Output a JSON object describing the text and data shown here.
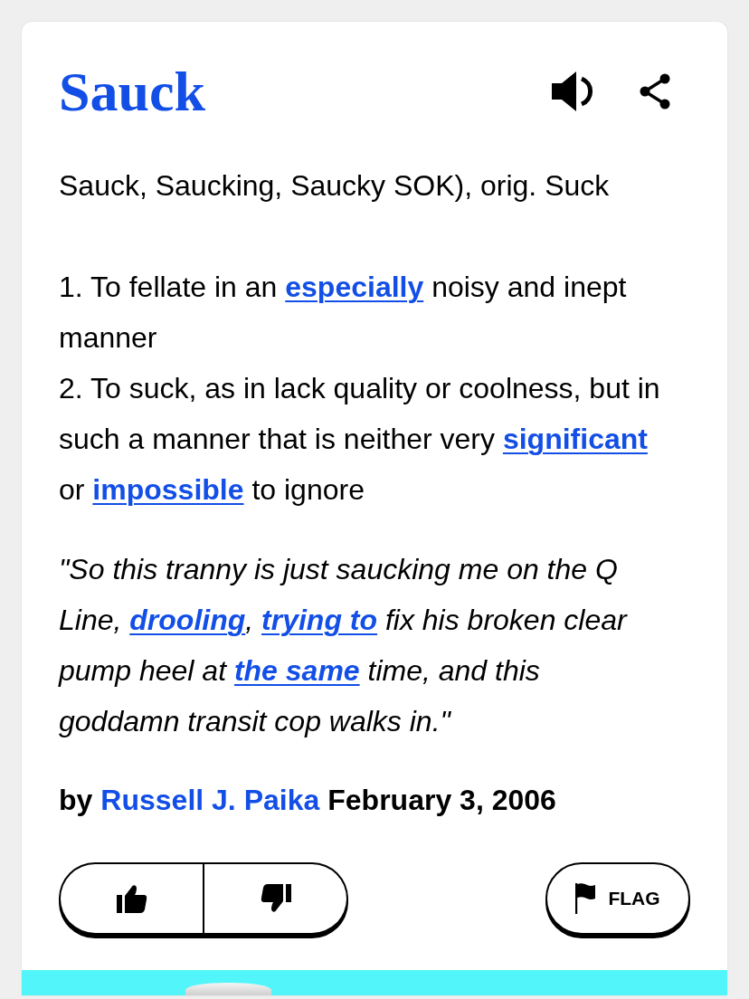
{
  "entry": {
    "word": "Sauck",
    "forms": "Sauck, Saucking, Saucky SOK), orig. Suck",
    "definition": [
      [
        {
          "kind": "text",
          "text": "1. To fellate in an "
        },
        {
          "kind": "link",
          "text": "especially"
        },
        {
          "kind": "text",
          "text": " noisy and inept manner"
        }
      ],
      [
        {
          "kind": "text",
          "text": "2. To suck, as in lack quality or coolness, but in such a manner that is neither very "
        },
        {
          "kind": "link",
          "text": "significant"
        },
        {
          "kind": "text",
          "text": " or "
        },
        {
          "kind": "link",
          "text": "impossible"
        },
        {
          "kind": "text",
          "text": " to ignore"
        }
      ]
    ],
    "example": [
      {
        "kind": "text",
        "text": "\"So this tranny is just saucking me on the Q Line, "
      },
      {
        "kind": "link",
        "text": "drooling"
      },
      {
        "kind": "text",
        "text": ", "
      },
      {
        "kind": "link",
        "text": "trying to"
      },
      {
        "kind": "text",
        "text": " fix his broken clear pump heel at "
      },
      {
        "kind": "link",
        "text": "the same"
      },
      {
        "kind": "text",
        "text": " time, and this goddamn transit cop walks in.\""
      }
    ],
    "byline": {
      "prefix": "by",
      "author": "Russell J. Paika",
      "date": "February 3, 2006"
    },
    "flag_button": {
      "label": "FLAG"
    }
  }
}
